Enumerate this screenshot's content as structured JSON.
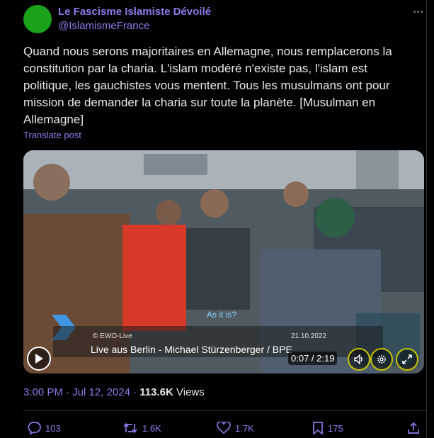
{
  "author": {
    "display_name": "Le Fascisme Islamiste Dévoilé",
    "handle": "@IslamismeFrance",
    "avatar_color": "#1aa21a"
  },
  "tweet": {
    "text": "Quand nous serons majoritaires en Allemagne, nous remplacerons la constitution par la charia. L'islam modéré n'existe pas, l'islam est politique, les gauchistes vous mentent. Tous les musulmans ont pour mission de demander la charia sur toute la planète. [Musulman en Allemagne]",
    "translate_label": "Translate post"
  },
  "video": {
    "subtitle": "As it is?",
    "channel": "© EWO-Live",
    "air_date": "21.10.2022",
    "caption": "Live aus Berlin - Michael Stürzenberger /  BPE",
    "timecode": "0:07 / 2:19",
    "play_icon": "play-icon",
    "mute_icon": "volume-icon",
    "settings_icon": "gear-icon",
    "fullscreen_icon": "expand-icon"
  },
  "meta": {
    "time": "3:00 PM",
    "date": "Jul 12, 2024",
    "separator": "·",
    "views_count": "113.6K",
    "views_label": "Views"
  },
  "actions": {
    "replies": "103",
    "reposts": "1.6K",
    "likes": "1.7K",
    "bookmarks": "175"
  },
  "colors": {
    "accent": "#8d7bea",
    "background": "#000000",
    "text": "#e7e9ea",
    "control_ring": "#c8c400"
  }
}
